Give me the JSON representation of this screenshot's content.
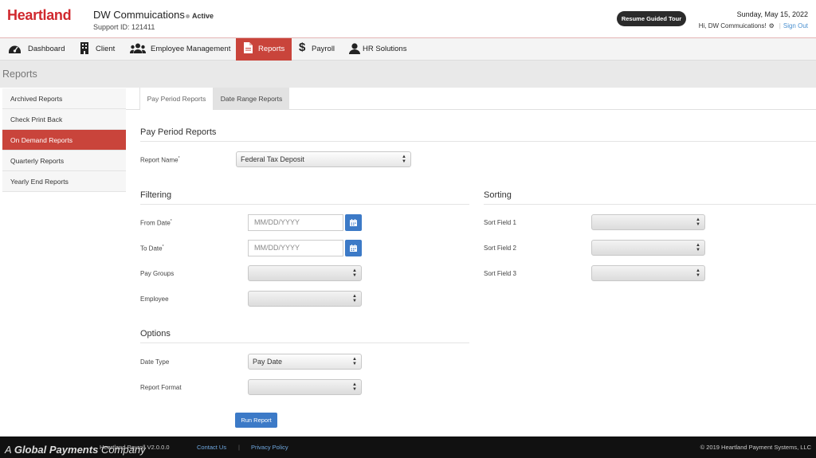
{
  "header": {
    "logo": "Heartland",
    "company_name": "DW Commuications",
    "status": "Active",
    "support_id": "Support ID: 121411",
    "tour_button": "Resume Guided Tour",
    "date": "Sunday, May 15, 2022",
    "greeting": "Hi, DW Commuications!",
    "sign_out": "Sign Out"
  },
  "nav": {
    "items": [
      {
        "label": "Dashboard",
        "icon": "dashboard-icon"
      },
      {
        "label": "Client",
        "icon": "building-icon"
      },
      {
        "label": "Employee Management",
        "icon": "users-icon"
      },
      {
        "label": "Reports",
        "icon": "document-icon"
      },
      {
        "label": "Payroll",
        "icon": "dollar-icon"
      },
      {
        "label": "HR Solutions",
        "icon": "user-icon"
      }
    ],
    "active": "Reports"
  },
  "page_title": "Reports",
  "sidebar": {
    "items": [
      {
        "label": "Archived Reports"
      },
      {
        "label": "Check Print Back"
      },
      {
        "label": "On Demand Reports"
      },
      {
        "label": "Quarterly Reports"
      },
      {
        "label": "Yearly End Reports"
      }
    ],
    "active": "On Demand Reports"
  },
  "tabs": {
    "pay_period": "Pay Period Reports",
    "date_range": "Date Range Reports"
  },
  "form": {
    "section_title": "Pay Period Reports",
    "report_name_label": "Report Name",
    "report_name_value": "Federal Tax Deposit",
    "filtering_title": "Filtering",
    "from_date_label": "From Date",
    "from_date_placeholder": "MM/DD/YYYY",
    "to_date_label": "To Date",
    "to_date_placeholder": "MM/DD/YYYY",
    "pay_groups_label": "Pay Groups",
    "employee_label": "Employee",
    "sorting_title": "Sorting",
    "sort1_label": "Sort Field 1",
    "sort2_label": "Sort Field 2",
    "sort3_label": "Sort Field 3",
    "options_title": "Options",
    "date_type_label": "Date Type",
    "date_type_value": "Pay Date",
    "report_format_label": "Report Format",
    "run_button": "Run Report",
    "required_mark": "*"
  },
  "footer": {
    "company_prefix": "A",
    "company_brand": "Global Payments",
    "company_suffix": "Company",
    "version": "Heartland Payroll V2.0.0.0",
    "contact": "Contact Us",
    "privacy": "Privacy Policy",
    "copyright": "© 2019 Heartland Payment Systems, LLC"
  },
  "colors": {
    "brand_red": "#d0282e",
    "active_red": "#c9443b",
    "accent_blue": "#3c7ac7"
  }
}
